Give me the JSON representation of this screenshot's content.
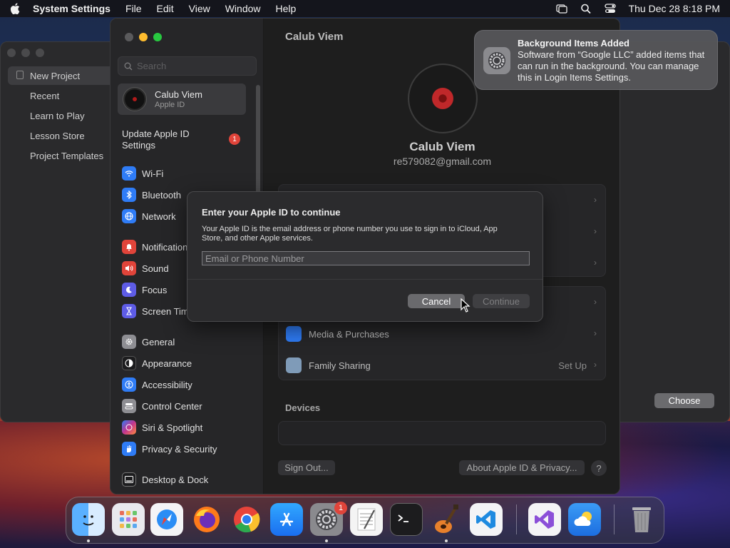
{
  "menubar": {
    "app_name": "System Settings",
    "menus": [
      "File",
      "Edit",
      "View",
      "Window",
      "Help"
    ],
    "datetime": "Thu Dec 28  8:18 PM"
  },
  "bg_window": {
    "items": [
      "New Project",
      "Recent",
      "Learn to Play",
      "Lesson Store",
      "Project Templates"
    ],
    "choose_label": "Choose"
  },
  "sidebar": {
    "search_placeholder": "Search",
    "profile_name": "Calub Viem",
    "profile_sub": "Apple ID",
    "update_label": "Update Apple ID Settings",
    "update_badge": "1",
    "items": [
      {
        "label": "Wi-Fi",
        "color": "#2f7cf6",
        "icon": "wifi-icon"
      },
      {
        "label": "Bluetooth",
        "color": "#2f7cf6",
        "icon": "bluetooth-icon"
      },
      {
        "label": "Network",
        "color": "#2f7cf6",
        "icon": "globe-icon"
      },
      {
        "label": "Notifications",
        "color": "#e0443a",
        "icon": "bell-icon"
      },
      {
        "label": "Sound",
        "color": "#e0443a",
        "icon": "speaker-icon"
      },
      {
        "label": "Focus",
        "color": "#5e5ce6",
        "icon": "moon-icon"
      },
      {
        "label": "Screen Time",
        "color": "#5e5ce6",
        "icon": "hourglass-icon"
      },
      {
        "label": "General",
        "color": "#8e8e93",
        "icon": "gear-icon"
      },
      {
        "label": "Appearance",
        "color": "#1c1c1e",
        "icon": "appearance-icon"
      },
      {
        "label": "Accessibility",
        "color": "#2f7cf6",
        "icon": "accessibility-icon"
      },
      {
        "label": "Control Center",
        "color": "#8e8e93",
        "icon": "control-center-icon"
      },
      {
        "label": "Siri & Spotlight",
        "color": "#c2358f",
        "icon": "siri-icon"
      },
      {
        "label": "Privacy & Security",
        "color": "#2f7cf6",
        "icon": "hand-icon"
      },
      {
        "label": "Desktop & Dock",
        "color": "#1c1c1e",
        "icon": "dock-icon"
      }
    ]
  },
  "content": {
    "title": "Calub Viem",
    "user_name": "Calub Viem",
    "email": "re579082@gmail.com",
    "rows": {
      "media": "Media & Purchases",
      "family": "Family Sharing",
      "family_value": "Set Up"
    },
    "devices_label": "Devices",
    "sign_out": "Sign Out...",
    "about": "About Apple ID & Privacy...",
    "help": "?"
  },
  "dialog": {
    "title": "Enter your Apple ID to continue",
    "body": "Your Apple ID is the email address or phone number you use to sign in to iCloud, App Store, and other Apple services.",
    "input_placeholder": "Email or Phone Number",
    "input_value": "",
    "cancel": "Cancel",
    "continue": "Continue"
  },
  "notification": {
    "title": "Background Items Added",
    "body": "Software from “Google LLC” added items that can run in the background. You can manage this in Login Items Settings."
  },
  "dock": {
    "settings_badge": "1"
  }
}
